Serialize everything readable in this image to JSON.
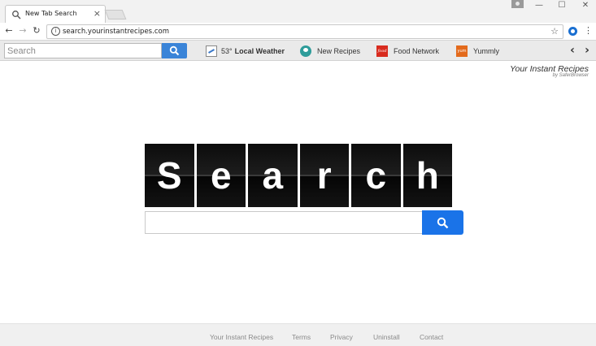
{
  "browser": {
    "tab_title": "New Tab Search",
    "tab_close": "×",
    "url": "search.yourinstantrecipes.com",
    "window_controls": {
      "minimize": "—",
      "maximize": "☐",
      "close": "✕"
    },
    "nav": {
      "back": "←",
      "forward": "→",
      "reload": "↻",
      "info": "i",
      "star": "☆",
      "menu": "⋮"
    }
  },
  "toolbar": {
    "search_placeholder": "Search",
    "weather_temp": "53°",
    "weather_label": "Local Weather",
    "new_recipes_label": "New Recipes",
    "food_network_label": "Food Network",
    "food_network_icon_text": "food",
    "yummly_label": "Yummly",
    "yummly_icon_text": "yum",
    "prev_arrow": "‹",
    "next_arrow": "›"
  },
  "brand": {
    "title": "Your Instant Recipes",
    "subtitle": "by SaferBrowser"
  },
  "hero": {
    "letters": [
      "S",
      "e",
      "a",
      "r",
      "c",
      "h"
    ]
  },
  "footer": {
    "links": [
      "Your Instant Recipes",
      "Terms",
      "Privacy",
      "Uninstall",
      "Contact"
    ]
  },
  "colors": {
    "accent_blue": "#1a73e8",
    "toolbar_search_blue": "#3a84d8",
    "tile_black": "#0c0c0c"
  }
}
